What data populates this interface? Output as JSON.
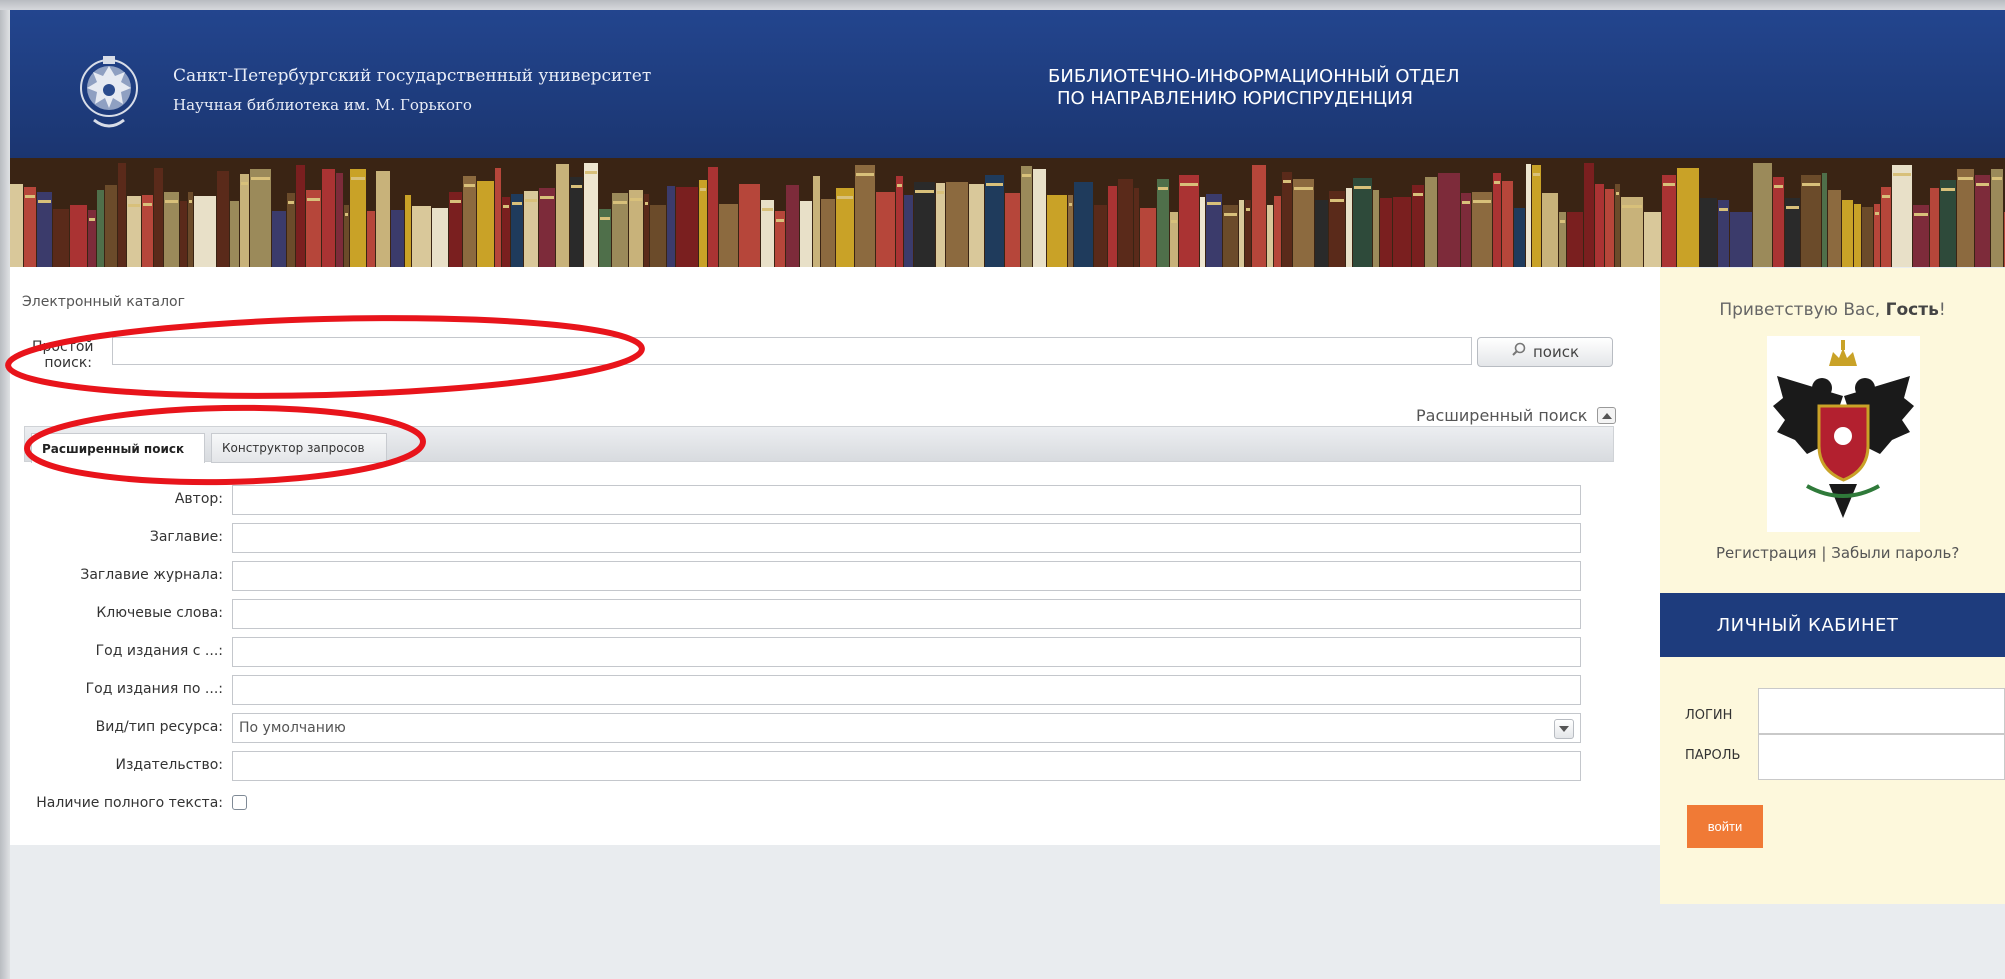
{
  "header": {
    "university": "Санкт-Петербургский государственный университет",
    "library": "Научная библиотека им. М. Горького",
    "department_line1": "БИБЛИОТЕЧНО-ИНФОРМАЦИОННЫЙ ОТДЕЛ",
    "department_line2": "ПО НАПРАВЛЕНИЮ ЮРИСПРУДЕНЦИЯ"
  },
  "catalog": {
    "breadcrumb": "Электронный каталог",
    "simple_search_label": "Простой поиск:",
    "simple_search_value": "",
    "search_button": "поиск",
    "advanced_toggle": "Расширенный поиск"
  },
  "tabs": [
    {
      "label": "Расширенный поиск",
      "active": true
    },
    {
      "label": "Конструктор запросов",
      "active": false
    }
  ],
  "form": {
    "fields": [
      {
        "label": "Автор:",
        "value": ""
      },
      {
        "label": "Заглавие:",
        "value": ""
      },
      {
        "label": "Заглавие журнала:",
        "value": ""
      },
      {
        "label": "Ключевые слова:",
        "value": ""
      },
      {
        "label": "Год издания с ...:",
        "value": ""
      },
      {
        "label": "Год издания по ...:",
        "value": ""
      }
    ],
    "resource_type_label": "Вид/тип ресурса:",
    "resource_type_value": "По умолчанию",
    "publisher_label": "Издательство:",
    "fulltext_label": "Наличие полного текста:",
    "fulltext_checked": false
  },
  "sidebar": {
    "greeting": "Приветствую Вас,",
    "guest": "Гость",
    "exclaim": "!",
    "register": "Регистрация",
    "separator": "|",
    "forgot": "Забыли пароль?",
    "cabinet_title": "ЛИЧНЫЙ КАБИНЕТ",
    "login_label": "ЛОГИН",
    "password_label": "ПАРОЛЬ",
    "enter_button": "войти"
  },
  "colors": {
    "header_blue": "#1e3c7d",
    "annotation_red": "#e8141b",
    "button_orange": "#f07a36",
    "sidebar_bg": "#fdf8dc"
  }
}
